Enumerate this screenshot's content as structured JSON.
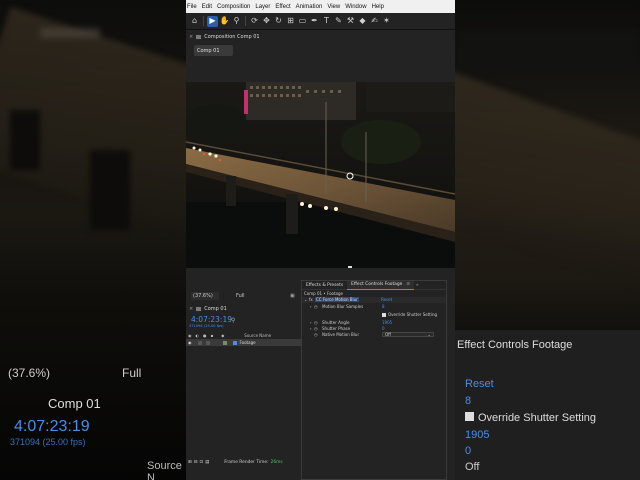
{
  "menu": [
    "File",
    "Edit",
    "Composition",
    "Layer",
    "Effect",
    "Animation",
    "View",
    "Window",
    "Help"
  ],
  "toolbar": {
    "icons": [
      "home-icon",
      "selection-tool-icon",
      "hand-tool-icon",
      "zoom-tool-icon",
      "orbit-tool-icon",
      "pan-behind-icon",
      "rotate-tool-icon",
      "rectangle-tool-icon",
      "pen-tool-icon",
      "type-tool-icon",
      "brush-tool-icon",
      "clone-stamp-icon",
      "eraser-icon",
      "roto-brush-icon",
      "puppet-pin-icon"
    ]
  },
  "composition": {
    "panel_title": "Composition  Comp 01",
    "tab_label": "Comp 01",
    "zoom": "(37.6%)",
    "resolution": "Full"
  },
  "timeline": {
    "tab_label": "Comp 01",
    "timecode": "4:07:23:19",
    "frames": "371094 (25.00 fps)",
    "search_placeholder": "",
    "header_source_name": "Source Name",
    "layer_name": "Footage",
    "frame_render_label": "Frame Render Time:",
    "frame_render_value": "26ms"
  },
  "effect_controls": {
    "tab_effects": "Effects & Presets",
    "tab_ec": "Effect Controls Footage",
    "source": "Comp 01 • Footage",
    "effect_name": "CC Force Motion Blur",
    "reset": "Reset",
    "rows": [
      {
        "label": "Motion Blur Samples",
        "value": "8"
      },
      {
        "label": "Override Shutter Setting",
        "value": ""
      },
      {
        "label": "Shutter Angle",
        "value": "1905"
      },
      {
        "label": "Shutter Phase",
        "value": "0"
      },
      {
        "label": "Native Motion Blur",
        "value": "Off"
      }
    ]
  },
  "background_zoom": {
    "zoom": "(37.6%)",
    "resolution": "Full",
    "comp_tab": "Comp 01",
    "timecode": "4:07:23:19",
    "frames": "371094 (25.00 fps)",
    "source": "Source N",
    "panel": "Effect Controls Footage",
    "reset": "Reset",
    "samples": "8",
    "override": "Override Shutter Setting",
    "angle": "1905",
    "phase": "0",
    "native": "Off"
  },
  "colors": {
    "accent": "#4c8ce6",
    "panel": "#232323",
    "menubar": "#f0f0f0"
  }
}
